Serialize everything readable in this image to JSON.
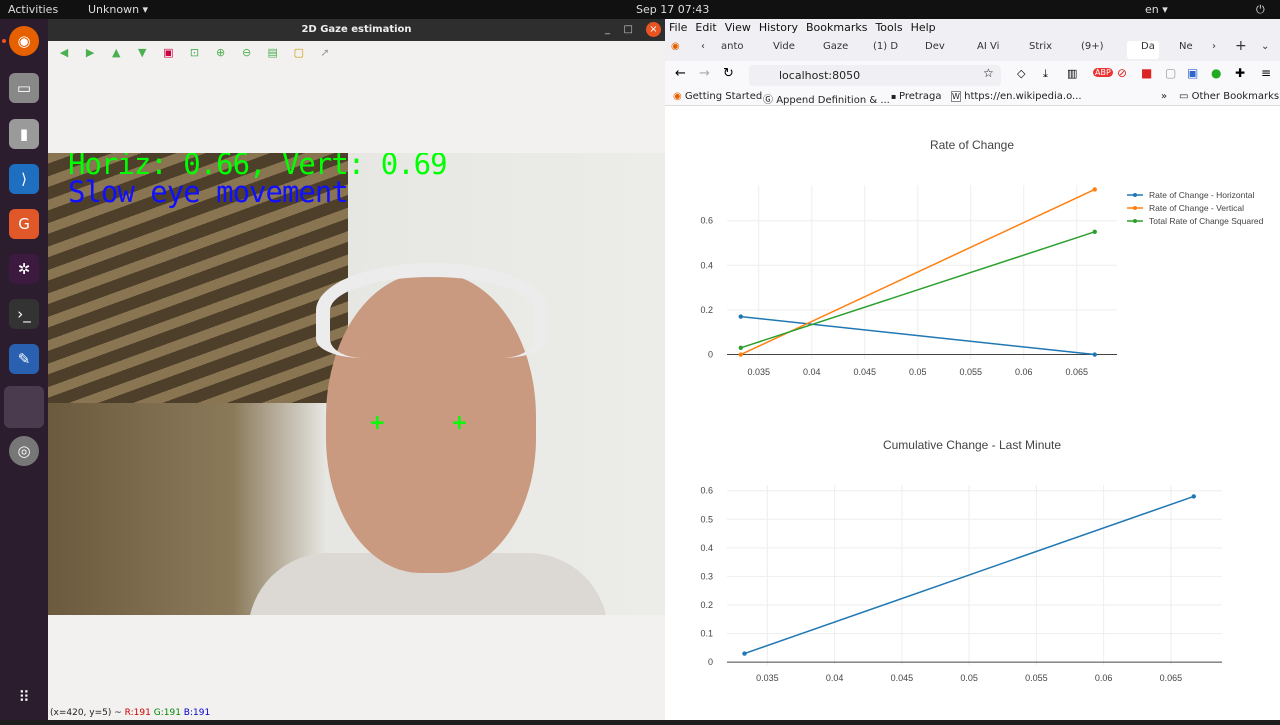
{
  "topbar": {
    "activities": "Activities",
    "app": "Unknown ▾",
    "clock": "Sep 17  07:43",
    "lang": "en ▾"
  },
  "opencv": {
    "title": "2D Gaze estimation",
    "overlay_line1": "Horiz: 0.66, Vert: 0.69",
    "overlay_line2": "Slow eye movement",
    "status_coords": "(x=420, y=5) ~",
    "status_r": "R:191",
    "status_g": "G:191",
    "status_b": "B:191"
  },
  "firefox": {
    "menu": [
      "File",
      "Edit",
      "View",
      "History",
      "Bookmarks",
      "Tools",
      "Help"
    ],
    "tabs": [
      "anto",
      "Vide",
      "Gaze",
      "(1) D",
      "Dev",
      "AI Vi",
      "Strix",
      "(9+)",
      "Da",
      "Ne"
    ],
    "url": "localhost:8050",
    "bookmarks": [
      "Getting Started",
      "Append Definition & ...",
      "Pretraga",
      "https://en.wikipedia.o...",
      "Other Bookmarks"
    ]
  },
  "chart_data": [
    {
      "type": "line",
      "title": "Rate of Change",
      "x": [
        0.0333,
        0.0667
      ],
      "xlim": [
        0.032,
        0.0688
      ],
      "ylim": [
        -0.02,
        0.76
      ],
      "xticks": [
        0.035,
        0.04,
        0.045,
        0.05,
        0.055,
        0.06,
        0.065
      ],
      "yticks": [
        0,
        0.2,
        0.4,
        0.6
      ],
      "grid": true,
      "legend": "top-right",
      "series": [
        {
          "name": "Rate of Change - Horizontal",
          "color": "#1f77b4",
          "values": [
            0.17,
            0.0
          ]
        },
        {
          "name": "Rate of Change - Vertical",
          "color": "#ff7f0e",
          "values": [
            0.0,
            0.74
          ]
        },
        {
          "name": "Total Rate of Change Squared",
          "color": "#2ca02c",
          "values": [
            0.03,
            0.55
          ]
        }
      ]
    },
    {
      "type": "line",
      "title": "Cumulative Change - Last Minute",
      "x": [
        0.0333,
        0.0667
      ],
      "xlim": [
        0.032,
        0.0688
      ],
      "ylim": [
        -0.01,
        0.62
      ],
      "xticks": [
        0.035,
        0.04,
        0.045,
        0.05,
        0.055,
        0.06,
        0.065
      ],
      "yticks": [
        0,
        0.1,
        0.2,
        0.3,
        0.4,
        0.5,
        0.6
      ],
      "grid": true,
      "series": [
        {
          "color": "#1f77b4",
          "values": [
            0.03,
            0.58
          ]
        }
      ]
    }
  ]
}
